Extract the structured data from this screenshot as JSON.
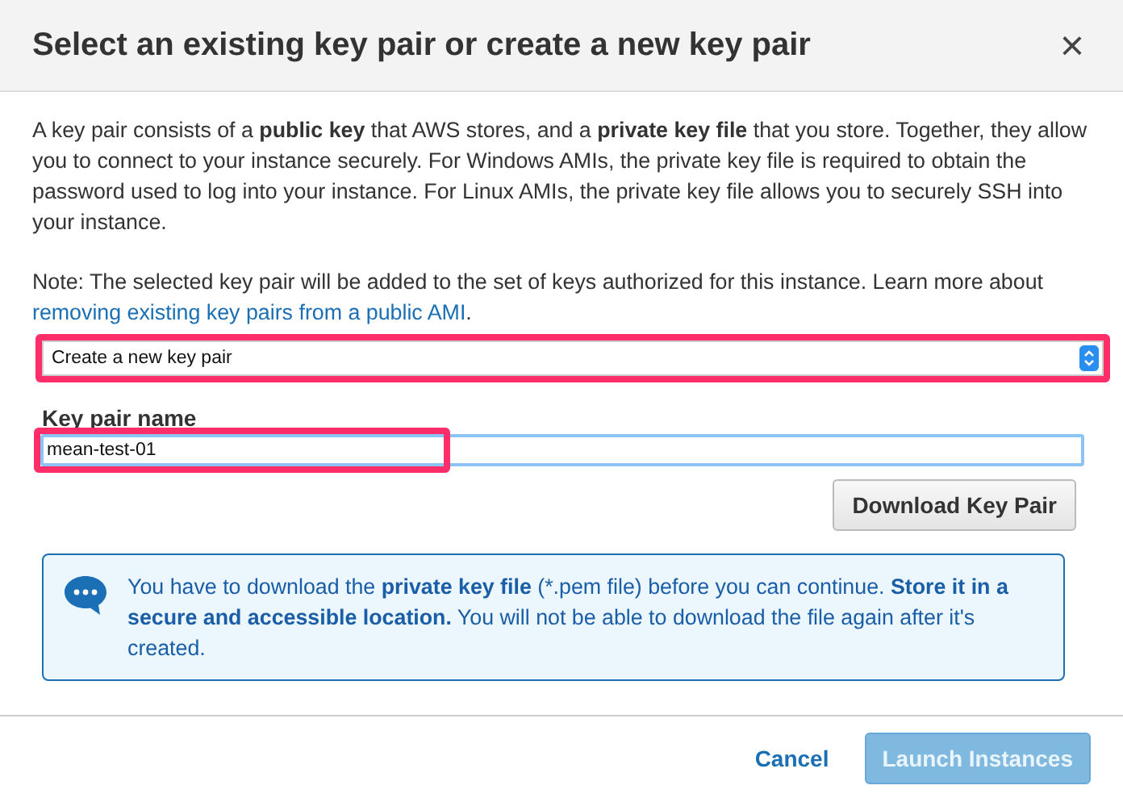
{
  "dialog": {
    "title": "Select an existing key pair or create a new key pair",
    "close": "×"
  },
  "description": "A key pair consists of a **public key** that AWS stores, and a **private key file** that you store. Together, they allow you to connect to your instance securely. For Windows AMIs, the private key file is required to obtain the password used to log into your instance. For Linux AMIs, the private key file allows you to securely SSH into your instance.",
  "note": {
    "text": "Note: The selected key pair will be added to the set of keys authorized for this instance. Learn more about",
    "link": "removing existing key pairs from a public AMI",
    "after": "."
  },
  "key_pair_select": {
    "value": "Create a new key pair",
    "highlighted": true
  },
  "key_pair_name": {
    "label": "Key pair name",
    "value": "mean-test-01",
    "highlighted": true
  },
  "download_button": {
    "label": "Download Key Pair"
  },
  "info": "You have to download the **private key file** (*.pem file) before you can continue. **Store it in a secure and accessible location.** You will not be able to download the file again after it's created.",
  "footer": {
    "cancel": "Cancel",
    "launch": {
      "label": "Launch Instances",
      "disabled": true
    }
  }
}
